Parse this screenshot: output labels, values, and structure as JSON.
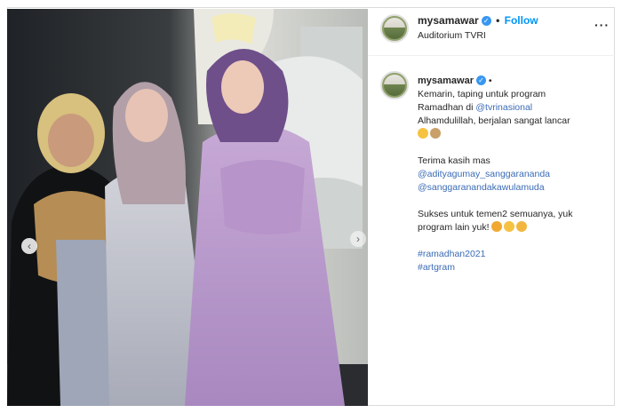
{
  "post": {
    "username": "mysamawar",
    "follow_label": "Follow",
    "location": "Auditorium TVRI",
    "more_label": "···"
  },
  "caption": {
    "username": "mysamawar",
    "line1": "Kemarin, taping untuk program",
    "line2_text": "Ramadhan di ",
    "line2_mention": "@tvrinasional",
    "line3": "Alhamdulillah, berjalan sangat lancar",
    "line4": "Terima kasih mas",
    "mention1": "@adityagumay_sanggarananda",
    "mention2": "@sanggaranandakawulamuda",
    "line5": "Sukses untuk temen2 semuanya, yuk",
    "line6": "program lain yuk!",
    "hashtag1": "#ramadhan2021",
    "hashtag2": "#artgram"
  },
  "colors": {
    "link": "#0095f6",
    "mention": "#3b6bb5",
    "verified": "#3897f0"
  }
}
